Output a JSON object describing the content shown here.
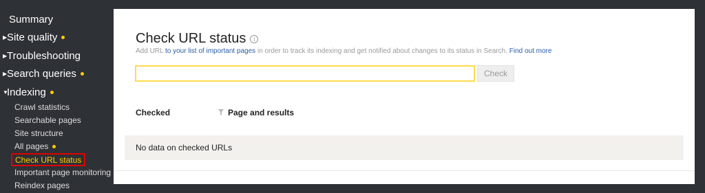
{
  "sidebar": {
    "summary": "Summary",
    "sections": [
      {
        "label": "Site quality",
        "has_dot": true
      },
      {
        "label": "Troubleshooting",
        "has_dot": false
      },
      {
        "label": "Search queries",
        "has_dot": true
      },
      {
        "label": "Indexing",
        "has_dot": true
      }
    ],
    "indexing_items": [
      {
        "label": "Crawl statistics",
        "has_dot": false,
        "active": false
      },
      {
        "label": "Searchable pages",
        "has_dot": false,
        "active": false
      },
      {
        "label": "Site structure",
        "has_dot": false,
        "active": false
      },
      {
        "label": "All pages",
        "has_dot": true,
        "active": false
      },
      {
        "label": "Check URL status",
        "has_dot": false,
        "active": true
      },
      {
        "label": "Important page monitoring",
        "has_dot": false,
        "active": false
      },
      {
        "label": "Reindex pages",
        "has_dot": false,
        "active": false
      }
    ]
  },
  "main": {
    "title": "Check URL status",
    "subtitle_prefix": "Add URL",
    "subtitle_link": "to your list of important pages",
    "subtitle_rest": "in order to track its indexing and get notified about changes to its status in Search.",
    "find_out_more": "Find out more",
    "input_value": "",
    "check_button": "Check",
    "columns": {
      "checked": "Checked",
      "page_results": "Page and results"
    },
    "empty_message": "No data on checked URLs"
  },
  "colors": {
    "accent_yellow": "#ffcc00",
    "highlight_red": "#e00000",
    "link_blue": "#2a5da8"
  },
  "icons": {
    "info": "info-circle-icon",
    "filter": "funnel-filter-icon",
    "expand": "triangle-right-icon",
    "collapse": "triangle-down-icon"
  }
}
